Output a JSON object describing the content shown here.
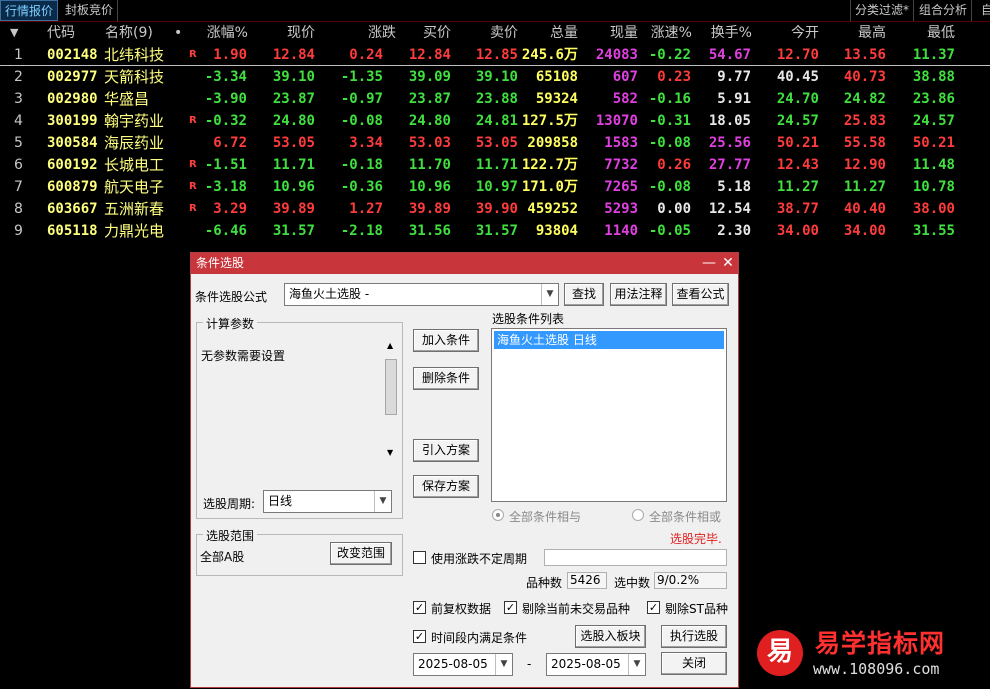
{
  "top_tabs": {
    "left": [
      "行情报价",
      "封板竞价"
    ],
    "right": [
      "分类过滤*",
      "组合分析",
      "自"
    ]
  },
  "table": {
    "headers": [
      "代码",
      "名称(9)",
      "•",
      "涨幅%",
      "现价",
      "涨跌",
      "买价",
      "卖价",
      "总量",
      "现量",
      "涨速%",
      "换手%",
      "今开",
      "最高",
      "最低"
    ],
    "sort_arrow": "▼",
    "rows": [
      {
        "idx": "1",
        "code": "002148",
        "name": "北纬科技",
        "flag": "R",
        "chg_pct": "1.90",
        "price": "12.84",
        "chg": "0.24",
        "bid": "12.84",
        "ask": "12.85",
        "vol": "245.6万",
        "cur": "24083",
        "speed": "-0.22",
        "turn": "54.67",
        "open": "12.70",
        "high": "13.56",
        "low": "11.37"
      },
      {
        "idx": "2",
        "code": "002977",
        "name": "天箭科技",
        "flag": "",
        "chg_pct": "-3.34",
        "price": "39.10",
        "chg": "-1.35",
        "bid": "39.09",
        "ask": "39.10",
        "vol": "65108",
        "cur": "607",
        "speed": "0.23",
        "turn": "9.77",
        "open": "40.45",
        "high": "40.73",
        "low": "38.88"
      },
      {
        "idx": "3",
        "code": "002980",
        "name": "华盛昌",
        "flag": "",
        "chg_pct": "-3.90",
        "price": "23.87",
        "chg": "-0.97",
        "bid": "23.87",
        "ask": "23.88",
        "vol": "59324",
        "cur": "582",
        "speed": "-0.16",
        "turn": "5.91",
        "open": "24.70",
        "high": "24.82",
        "low": "23.86"
      },
      {
        "idx": "4",
        "code": "300199",
        "name": "翰宇药业",
        "flag": "R",
        "chg_pct": "-0.32",
        "price": "24.80",
        "chg": "-0.08",
        "bid": "24.80",
        "ask": "24.81",
        "vol": "127.5万",
        "cur": "13070",
        "speed": "-0.31",
        "turn": "18.05",
        "open": "24.57",
        "high": "25.83",
        "low": "24.57"
      },
      {
        "idx": "5",
        "code": "300584",
        "name": "海辰药业",
        "flag": "",
        "chg_pct": "6.72",
        "price": "53.05",
        "chg": "3.34",
        "bid": "53.03",
        "ask": "53.05",
        "vol": "209858",
        "cur": "1583",
        "speed": "-0.08",
        "turn": "25.56",
        "open": "50.21",
        "high": "55.58",
        "low": "50.21"
      },
      {
        "idx": "6",
        "code": "600192",
        "name": "长城电工",
        "flag": "R",
        "chg_pct": "-1.51",
        "price": "11.71",
        "chg": "-0.18",
        "bid": "11.70",
        "ask": "11.71",
        "vol": "122.7万",
        "cur": "7732",
        "speed": "0.26",
        "turn": "27.77",
        "open": "12.43",
        "high": "12.90",
        "low": "11.48"
      },
      {
        "idx": "7",
        "code": "600879",
        "name": "航天电子",
        "flag": "R",
        "chg_pct": "-3.18",
        "price": "10.96",
        "chg": "-0.36",
        "bid": "10.96",
        "ask": "10.97",
        "vol": "171.0万",
        "cur": "7265",
        "speed": "-0.08",
        "turn": "5.18",
        "open": "11.27",
        "high": "11.27",
        "low": "10.78"
      },
      {
        "idx": "8",
        "code": "603667",
        "name": "五洲新春",
        "flag": "R",
        "chg_pct": "3.29",
        "price": "39.89",
        "chg": "1.27",
        "bid": "39.89",
        "ask": "39.90",
        "vol": "459252",
        "cur": "5293",
        "speed": "0.00",
        "turn": "12.54",
        "open": "38.77",
        "high": "40.40",
        "low": "38.00"
      },
      {
        "idx": "9",
        "code": "605118",
        "name": "力鼎光电",
        "flag": "",
        "chg_pct": "-6.46",
        "price": "31.57",
        "chg": "-2.18",
        "bid": "31.56",
        "ask": "31.57",
        "vol": "93804",
        "cur": "1140",
        "speed": "-0.05",
        "turn": "2.30",
        "open": "34.00",
        "high": "34.00",
        "low": "31.55"
      }
    ],
    "row_colors": [
      {
        "chg_pct": "#ff3c3c",
        "price": "#ff3c3c",
        "chg": "#ff3c3c",
        "bid": "#ff3c3c",
        "ask": "#ff3c3c",
        "cur": "#e040e0",
        "speed": "#40e040",
        "turn": "#e040e0",
        "open": "#ff3c3c",
        "high": "#ff3c3c",
        "low": "#40e040"
      },
      {
        "chg_pct": "#40e040",
        "price": "#40e040",
        "chg": "#40e040",
        "bid": "#40e040",
        "ask": "#40e040",
        "cur": "#e040e0",
        "speed": "#ff3c3c",
        "turn": "#e8e8e8",
        "open": "#e8e8e8",
        "high": "#ff3c3c",
        "low": "#40e040"
      },
      {
        "chg_pct": "#40e040",
        "price": "#40e040",
        "chg": "#40e040",
        "bid": "#40e040",
        "ask": "#40e040",
        "cur": "#e040e0",
        "speed": "#40e040",
        "turn": "#e8e8e8",
        "open": "#40e040",
        "high": "#40e040",
        "low": "#40e040"
      },
      {
        "chg_pct": "#40e040",
        "price": "#40e040",
        "chg": "#40e040",
        "bid": "#40e040",
        "ask": "#40e040",
        "cur": "#e040e0",
        "speed": "#40e040",
        "turn": "#e8e8e8",
        "open": "#40e040",
        "high": "#ff3c3c",
        "low": "#40e040"
      },
      {
        "chg_pct": "#ff3c3c",
        "price": "#ff3c3c",
        "chg": "#ff3c3c",
        "bid": "#ff3c3c",
        "ask": "#ff3c3c",
        "cur": "#e040e0",
        "speed": "#40e040",
        "turn": "#e040e0",
        "open": "#ff3c3c",
        "high": "#ff3c3c",
        "low": "#ff3c3c"
      },
      {
        "chg_pct": "#40e040",
        "price": "#40e040",
        "chg": "#40e040",
        "bid": "#40e040",
        "ask": "#40e040",
        "cur": "#e040e0",
        "speed": "#ff3c3c",
        "turn": "#e040e0",
        "open": "#ff3c3c",
        "high": "#ff3c3c",
        "low": "#40e040"
      },
      {
        "chg_pct": "#40e040",
        "price": "#40e040",
        "chg": "#40e040",
        "bid": "#40e040",
        "ask": "#40e040",
        "cur": "#e040e0",
        "speed": "#40e040",
        "turn": "#e8e8e8",
        "open": "#40e040",
        "high": "#40e040",
        "low": "#40e040"
      },
      {
        "chg_pct": "#ff3c3c",
        "price": "#ff3c3c",
        "chg": "#ff3c3c",
        "bid": "#ff3c3c",
        "ask": "#ff3c3c",
        "cur": "#e040e0",
        "speed": "#e8e8e8",
        "turn": "#e8e8e8",
        "open": "#ff3c3c",
        "high": "#ff3c3c",
        "low": "#ff3c3c"
      },
      {
        "chg_pct": "#40e040",
        "price": "#40e040",
        "chg": "#40e040",
        "bid": "#40e040",
        "ask": "#40e040",
        "cur": "#e040e0",
        "speed": "#40e040",
        "turn": "#e8e8e8",
        "open": "#ff3c3c",
        "high": "#ff3c3c",
        "low": "#40e040"
      }
    ],
    "vol_color": "#ffff60"
  },
  "dialog": {
    "title": "条件选股",
    "min_icon": "—",
    "close_icon": "✕",
    "formula_label": "条件选股公式",
    "formula_value": "海鱼火土选股  -",
    "btn_find": "查找",
    "btn_usage": "用法注释",
    "btn_view": "查看公式",
    "params_group": "计算参数",
    "params_text": "无参数需要设置",
    "period_label": "选股周期:",
    "period_value": "日线",
    "btn_add": "加入条件",
    "btn_delete": "删除条件",
    "btn_import": "引入方案",
    "btn_save": "保存方案",
    "cond_list_label": "选股条件列表",
    "cond_items": [
      "海鱼火土选股  日线"
    ],
    "radio_and": "全部条件相与",
    "radio_or": "全部条件相或",
    "status": "选股完毕.",
    "range_group": "选股范围",
    "range_value": "全部A股",
    "btn_change_range": "改变范围",
    "chk_uncertain": "使用涨跌不定周期",
    "count_label": "品种数",
    "count_value": "5426",
    "selected_label": "选中数",
    "selected_value": "9/0.2%",
    "chk_restore": "前复权数据",
    "chk_exclude_nontrade": "剔除当前未交易品种",
    "chk_exclude_st": "剔除ST品种",
    "chk_period": "时间段内满足条件",
    "btn_to_block": "选股入板块",
    "btn_execute": "执行选股",
    "btn_close": "关闭",
    "date_from": "2025-08-05",
    "date_sep": "-",
    "date_to": "2025-08-05",
    "check_mark": "✓"
  },
  "watermark": {
    "logo_char": "易",
    "title": "易学指标网",
    "url": "www.108096.com"
  }
}
